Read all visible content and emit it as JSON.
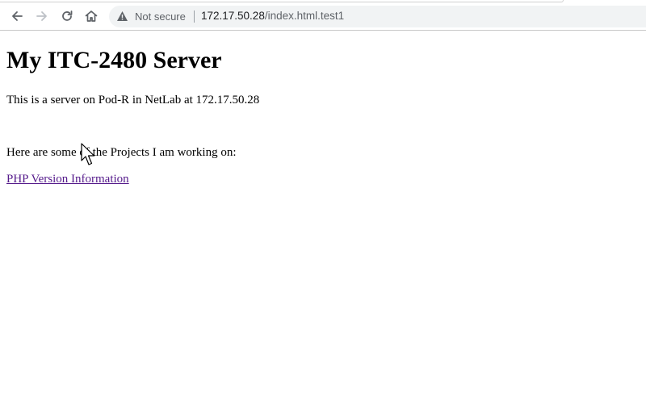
{
  "browser": {
    "security_label": "Not secure",
    "url_host": "172.17.50.28",
    "url_path": "/index.html.test1",
    "icons": {
      "back": "arrow-left-icon",
      "forward": "arrow-right-icon",
      "reload": "reload-icon",
      "home": "home-icon",
      "security": "warning-triangle-icon"
    }
  },
  "page": {
    "heading": "My ITC-2480 Server",
    "intro": "This is a server on Pod-R in NetLab at 172.17.50.28",
    "projects_intro": "Here are some of the Projects I am working on:",
    "link_label": "PHP Version Information"
  },
  "colors": {
    "link_visited": "#551a8b",
    "omnibox_bg": "#f1f3f4"
  }
}
